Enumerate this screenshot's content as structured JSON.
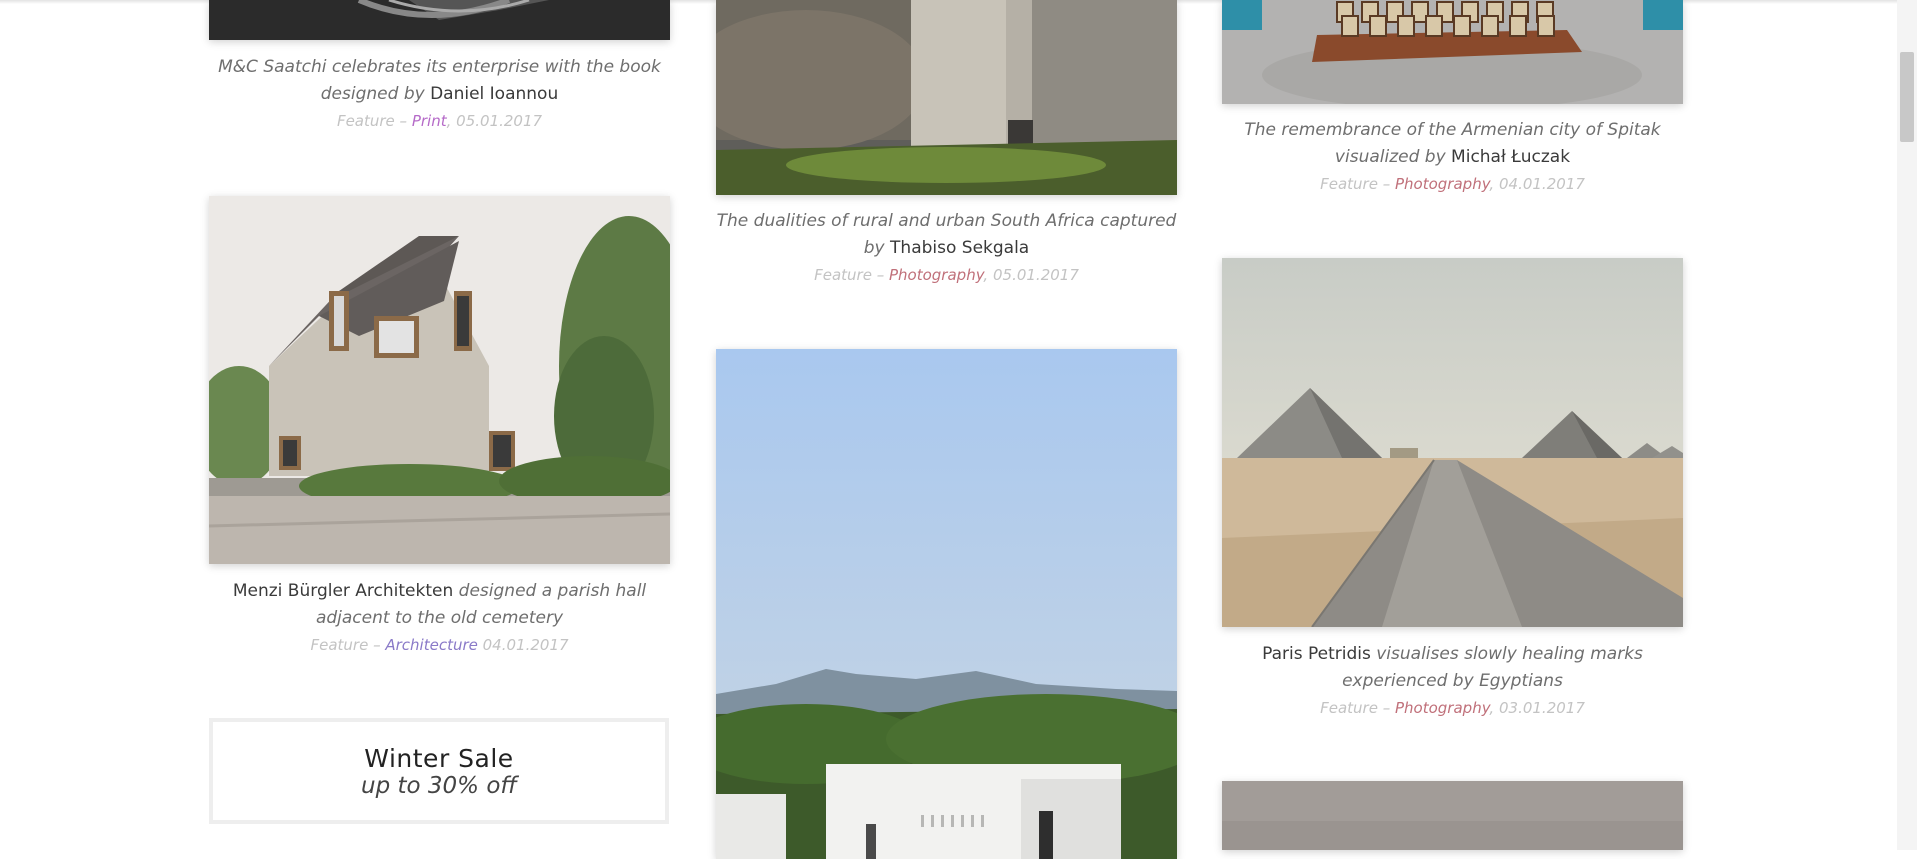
{
  "posts": [
    {
      "caption_lead": "M&C Saatchi celebrates its enterprise with the book designed by",
      "caption_name": "Daniel Ioannou",
      "meta_prefix": "Feature –",
      "category": "Print",
      "date": "05.01.2017",
      "category_color": "#b56ac8"
    },
    {
      "caption_lead": "The dualities of rural and urban South Africa captured by",
      "caption_name": "Thabiso Sekgala",
      "meta_prefix": "Feature –",
      "category": "Photography",
      "date": "05.01.2017",
      "category_color": "#c0707a"
    },
    {
      "caption_lead": "The remembrance of the Armenian city of Spitak visualized by",
      "caption_name": "Michał Łuczak",
      "meta_prefix": "Feature –",
      "category": "Photography",
      "date": "04.01.2017",
      "category_color": "#c0707a"
    },
    {
      "caption_name": "Menzi Bürgler Architekten",
      "caption_tail": "designed a parish hall adjacent to the old cemetery",
      "meta_prefix": "Feature –",
      "category": "Architecture",
      "date": "04.01.2017",
      "category_color": "#8a7ac8"
    },
    {
      "caption_name": "Paris Petridis",
      "caption_tail": "visualises slowly healing marks experienced by Egyptians",
      "meta_prefix": "Feature –",
      "category": "Photography",
      "date": "03.01.2017",
      "category_color": "#c0707a"
    }
  ],
  "sale": {
    "title": "Winter Sale",
    "subtitle": "up to 30% off"
  }
}
